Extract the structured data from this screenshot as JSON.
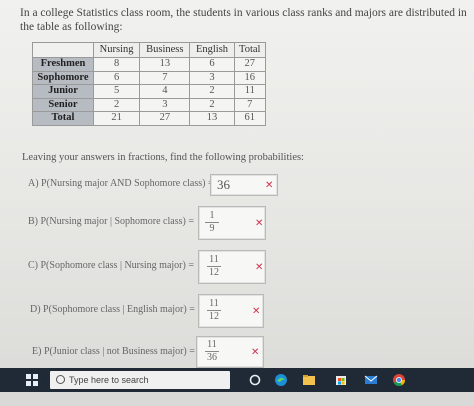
{
  "intro": "In a college Statistics class room, the students in various class ranks and majors are distributed in the table as following:",
  "table": {
    "headers": [
      "Nursing",
      "Business",
      "English",
      "Total"
    ],
    "rows": [
      {
        "label": "Freshmen",
        "values": [
          "8",
          "13",
          "6",
          "27"
        ]
      },
      {
        "label": "Sophomore",
        "values": [
          "6",
          "7",
          "3",
          "16"
        ]
      },
      {
        "label": "Junior",
        "values": [
          "5",
          "4",
          "2",
          "11"
        ]
      },
      {
        "label": "Senior",
        "values": [
          "2",
          "3",
          "2",
          "7"
        ]
      },
      {
        "label": "Total",
        "values": [
          "21",
          "27",
          "13",
          "61"
        ]
      }
    ]
  },
  "instructions": "Leaving your answers in fractions, find the following probabilities:",
  "questions": [
    {
      "label": "A) P(Nursing major AND Sophomore class) =",
      "answer": "36",
      "mark": "✕"
    },
    {
      "label": "B) P(Nursing major | Sophomore class) =",
      "num": "1",
      "den": "9",
      "mark": "✕"
    },
    {
      "label": "C) P(Sophomore class | Nursing major) =",
      "num": "11",
      "den": "12",
      "mark": "✕"
    },
    {
      "label": "D) P(Sophomore class | English major) =",
      "num": "11",
      "den": "12",
      "mark": "✕"
    },
    {
      "label": "E) P(Junior class | not Business major) =",
      "num": "11",
      "den": "36",
      "mark": "✕"
    }
  ],
  "taskbar": {
    "search_placeholder": "Type here to search"
  },
  "colors": {
    "taskbar": "#1f2a36",
    "wrong_mark": "#d0304a",
    "row_header": "#b7bcc2"
  }
}
